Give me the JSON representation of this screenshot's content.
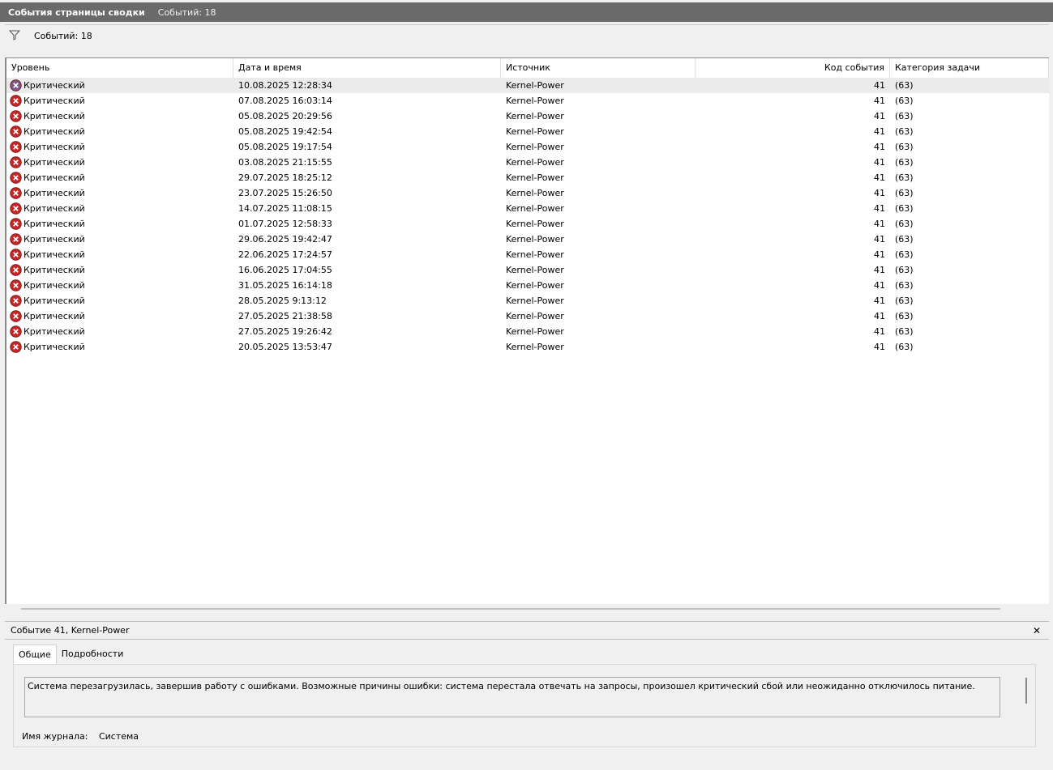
{
  "titlebar": {
    "title": "События страницы сводки",
    "count": "Событий: 18"
  },
  "toolbar": {
    "filter_icon": "filter-icon",
    "count": "Событий: 18"
  },
  "table": {
    "columns": [
      "Уровень",
      "Дата и время",
      "Источник",
      "Код события",
      "Категория задачи"
    ],
    "rows": [
      [
        "Критический",
        "10.08.2025 12:28:34",
        "Kernel-Power",
        "41",
        "(63)"
      ],
      [
        "Критический",
        "07.08.2025 16:03:14",
        "Kernel-Power",
        "41",
        "(63)"
      ],
      [
        "Критический",
        "05.08.2025 20:29:56",
        "Kernel-Power",
        "41",
        "(63)"
      ],
      [
        "Критический",
        "05.08.2025 19:42:54",
        "Kernel-Power",
        "41",
        "(63)"
      ],
      [
        "Критический",
        "05.08.2025 19:17:54",
        "Kernel-Power",
        "41",
        "(63)"
      ],
      [
        "Критический",
        "03.08.2025 21:15:55",
        "Kernel-Power",
        "41",
        "(63)"
      ],
      [
        "Критический",
        "29.07.2025 18:25:12",
        "Kernel-Power",
        "41",
        "(63)"
      ],
      [
        "Критический",
        "23.07.2025 15:26:50",
        "Kernel-Power",
        "41",
        "(63)"
      ],
      [
        "Критический",
        "14.07.2025 11:08:15",
        "Kernel-Power",
        "41",
        "(63)"
      ],
      [
        "Критический",
        "01.07.2025 12:58:33",
        "Kernel-Power",
        "41",
        "(63)"
      ],
      [
        "Критический",
        "29.06.2025 19:42:47",
        "Kernel-Power",
        "41",
        "(63)"
      ],
      [
        "Критический",
        "22.06.2025 17:24:57",
        "Kernel-Power",
        "41",
        "(63)"
      ],
      [
        "Критический",
        "16.06.2025 17:04:55",
        "Kernel-Power",
        "41",
        "(63)"
      ],
      [
        "Критический",
        "31.05.2025 16:14:18",
        "Kernel-Power",
        "41",
        "(63)"
      ],
      [
        "Критический",
        "28.05.2025 9:13:12",
        "Kernel-Power",
        "41",
        "(63)"
      ],
      [
        "Критический",
        "27.05.2025 21:38:58",
        "Kernel-Power",
        "41",
        "(63)"
      ],
      [
        "Критический",
        "27.05.2025 19:26:42",
        "Kernel-Power",
        "41",
        "(63)"
      ],
      [
        "Критический",
        "20.05.2025 13:53:47",
        "Kernel-Power",
        "41",
        "(63)"
      ]
    ],
    "level_icon": "critical-error-icon",
    "selected_row": 0
  },
  "detail": {
    "title": "Событие 41, Kernel-Power",
    "close": "✕",
    "tabs": [
      "Общие",
      "Подробности"
    ],
    "description": "Система перезагрузилась, завершив работу с ошибками. Возможные причины ошибки: система перестала отвечать на запросы, произошел критический сбой или неожиданно отключилось питание.",
    "log_label": "Имя журнала:",
    "log_value": "Система"
  },
  "colors": {
    "titlebar": "#6a6a6a",
    "critical": "#c62828",
    "selected_row": "#ebebeb"
  }
}
